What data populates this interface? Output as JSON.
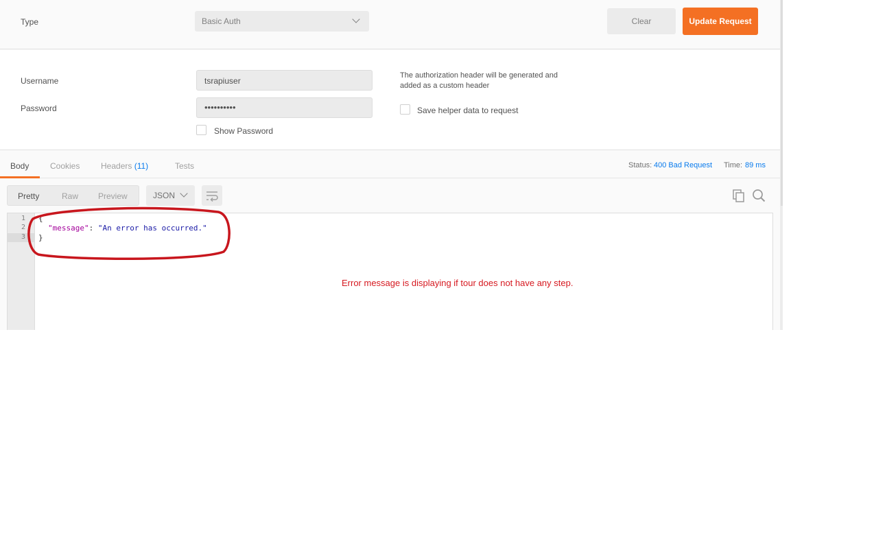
{
  "auth": {
    "type_label": "Type",
    "type_value": "Basic Auth",
    "clear_label": "Clear",
    "update_label": "Update Request",
    "username_label": "Username",
    "username_value": "tsrapiuser",
    "password_label": "Password",
    "password_masked": "••••••••••",
    "show_password_label": "Show Password",
    "helper_text_line1": "The authorization header will be generated and",
    "helper_text_line2": "added as a custom header",
    "save_helper_label": "Save helper data to request"
  },
  "response": {
    "tabs": [
      {
        "label": "Body"
      },
      {
        "label": "Cookies"
      },
      {
        "label": "Headers"
      },
      {
        "label": "Tests"
      }
    ],
    "headers_count": "(11)",
    "status_label": "Status:",
    "status_value": "400 Bad Request",
    "time_label": "Time:",
    "time_value": "89 ms",
    "view_modes": {
      "pretty": "Pretty",
      "raw": "Raw",
      "preview": "Preview"
    },
    "format": "JSON",
    "line_numbers": [
      "1",
      "2",
      "3"
    ],
    "body": {
      "open": "{",
      "key": "\"message\"",
      "colon": ": ",
      "value": "\"An error has occurred.\"",
      "close": "}"
    }
  },
  "annotation": {
    "text": "Error message is displaying if tour does not have any step.",
    "color": "#d6181f"
  },
  "colors": {
    "accent": "#f47023",
    "link": "#097bed"
  },
  "icons": [
    "chevron-down-icon",
    "wrap-lines-icon",
    "copy-icon",
    "search-icon"
  ]
}
